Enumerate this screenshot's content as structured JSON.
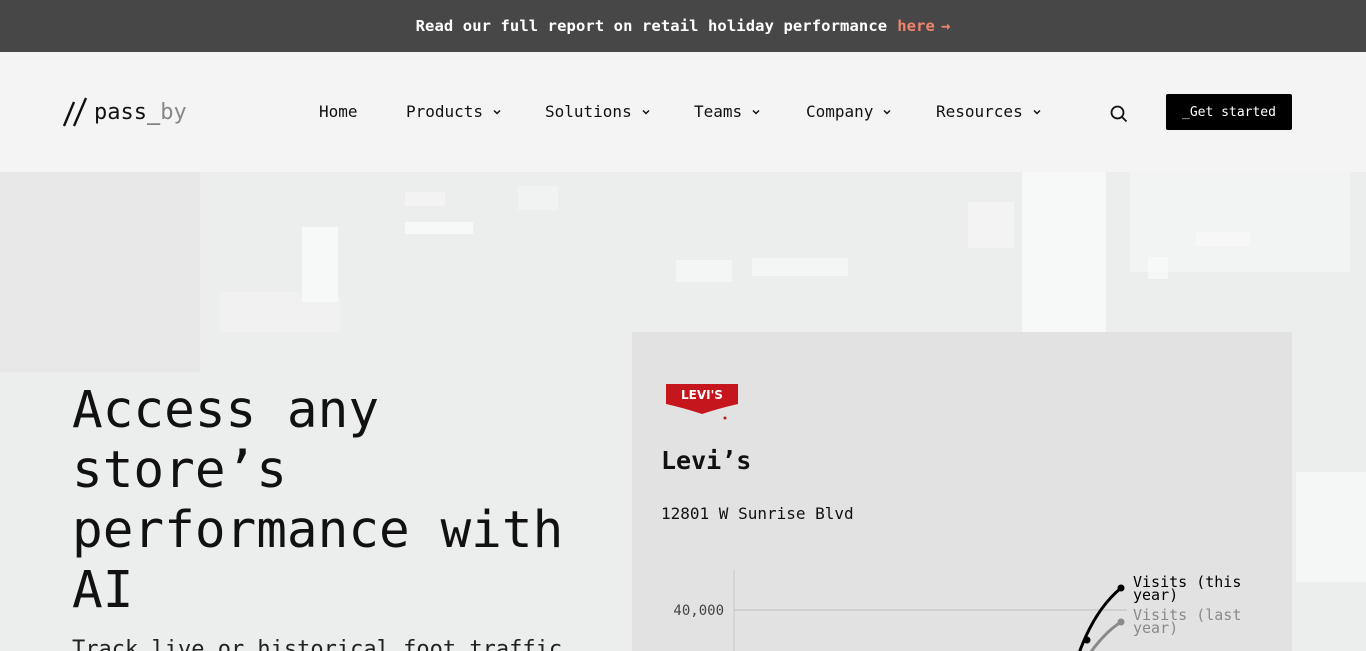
{
  "banner": {
    "text": "Read our full report on retail holiday performance",
    "link_label": "here",
    "arrow": "→"
  },
  "logo": {
    "name_main": "pass_",
    "name_suffix": "by"
  },
  "nav": {
    "items": [
      {
        "label": "Home",
        "dropdown": false
      },
      {
        "label": "Products",
        "dropdown": true
      },
      {
        "label": "Solutions",
        "dropdown": true
      },
      {
        "label": "Teams",
        "dropdown": true
      },
      {
        "label": "Company",
        "dropdown": true
      },
      {
        "label": "Resources",
        "dropdown": true
      }
    ],
    "search_icon": "search-icon",
    "cta_label": "_Get started"
  },
  "hero": {
    "headline": "Access any store’s performance with AI",
    "subline": "Track live or historical foot traffic"
  },
  "card": {
    "brand_logo_text": "LEVI'S",
    "store_name": "Levi’s",
    "address": "12801 W Sunrise Blvd"
  },
  "chart_data": {
    "type": "line",
    "y_tick_labels": [
      "40,000"
    ],
    "series": [
      {
        "name": "Visits (this year)",
        "color": "#000000"
      },
      {
        "name": "Visits (last year)",
        "color": "#888888"
      }
    ]
  },
  "colors": {
    "banner_bg": "#474747",
    "banner_link": "#f0836e",
    "cta_bg": "#000000",
    "levis_red": "#c4161c"
  }
}
